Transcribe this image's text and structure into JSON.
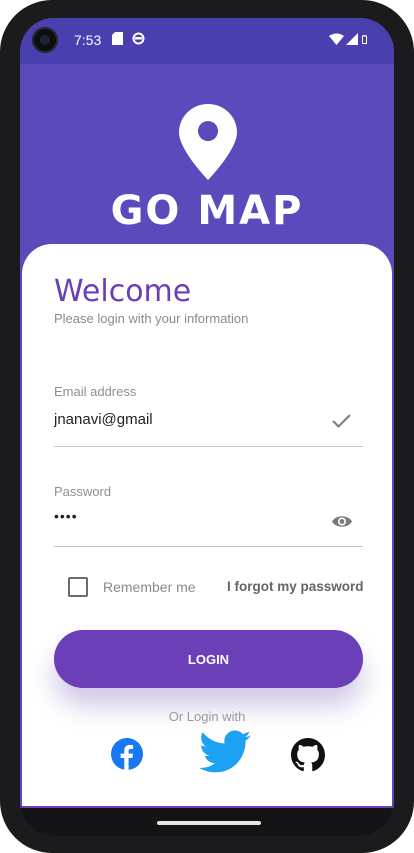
{
  "status": {
    "time": "7:53"
  },
  "brand": {
    "title": "GO MAP"
  },
  "login_card": {
    "heading": "Welcome",
    "subtitle": "Please login with your information",
    "email": {
      "label": "Email address",
      "value": "jnanavi@gmail"
    },
    "password": {
      "label": "Password",
      "value": "••••"
    },
    "remember_label": "Remember me",
    "forgot_label": "I forgot my password",
    "login_label": "LOGIN",
    "or_text": "Or Login with"
  },
  "colors": {
    "primary": "#6a3fb8",
    "header": "#5a4bbd",
    "facebook": "#1877f2",
    "twitter": "#1da1f2"
  },
  "icons": [
    "map-pin-icon",
    "check-icon",
    "eye-icon",
    "facebook-icon",
    "twitter-icon",
    "github-icon"
  ]
}
